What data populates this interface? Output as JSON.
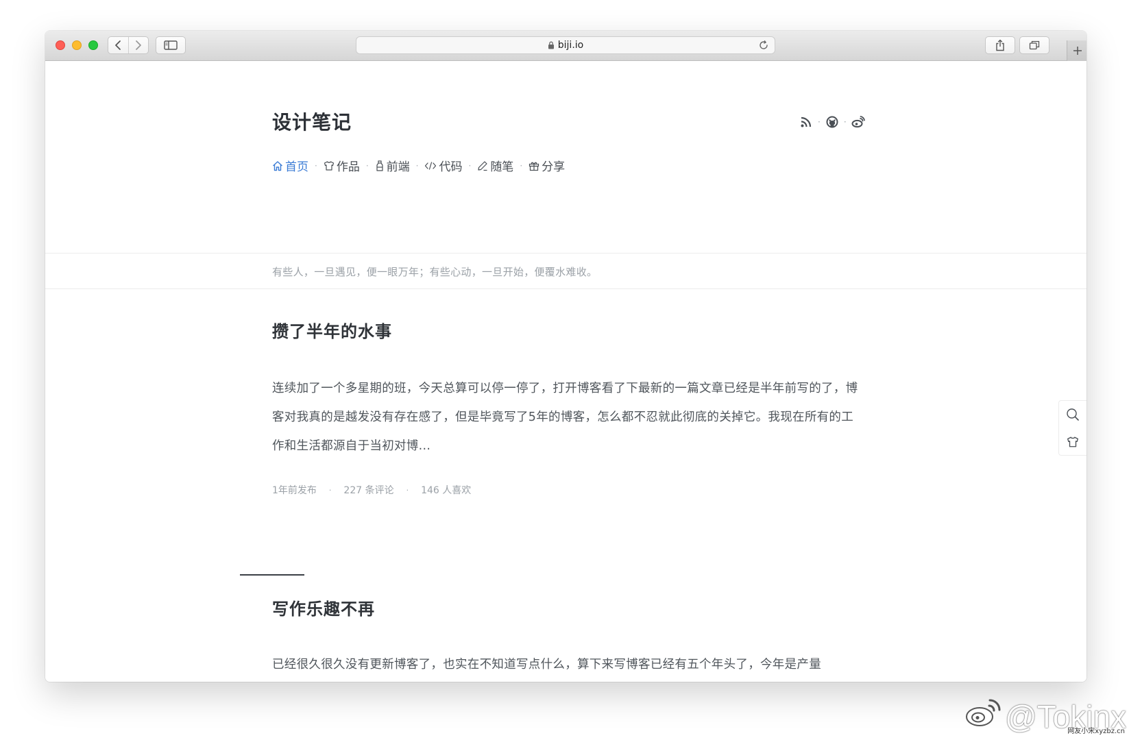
{
  "browser": {
    "url": "biji.io"
  },
  "site": {
    "title": "设计笔记",
    "social": [
      "rss-icon",
      "github-icon",
      "weibo-icon"
    ],
    "nav": [
      {
        "label": "首页",
        "icon": "home-icon",
        "active": true
      },
      {
        "label": "作品",
        "icon": "tshirt-icon",
        "active": false
      },
      {
        "label": "前端",
        "icon": "bottle-icon",
        "active": false
      },
      {
        "label": "代码",
        "icon": "code-icon",
        "active": false
      },
      {
        "label": "随笔",
        "icon": "pen-icon",
        "active": false
      },
      {
        "label": "分享",
        "icon": "gift-icon",
        "active": false
      }
    ],
    "quote": "有些人，一旦遇见，便一眼万年；有些心动，一旦开始，便覆水难收。"
  },
  "posts": [
    {
      "title": "攒了半年的水事",
      "excerpt": "连续加了一个多星期的班，今天总算可以停一停了，打开博客看了下最新的一篇文章已经是半年前写的了，博客对我真的是越发没有存在感了，但是毕竟写了5年的博客，怎么都不忍就此彻底的关掉它。我现在所有的工作和生活都源自于当初对博...",
      "published": "1年前发布",
      "comments": "227 条评论",
      "likes": "146 人喜欢"
    },
    {
      "title": "写作乐趣不再",
      "excerpt": "已经很久很久没有更新博客了，也实在不知道写点什么，算下来写博客已经有五个年头了，今年是产量"
    }
  ],
  "side_tools": [
    "search-icon",
    "tshirt-icon"
  ],
  "watermark": {
    "handle": "@Tokinx",
    "small": "网友小宋xyzbz.cn"
  },
  "colors": {
    "accent": "#3a7bd5",
    "text": "#2f3338",
    "muted": "#9ba1a7"
  }
}
